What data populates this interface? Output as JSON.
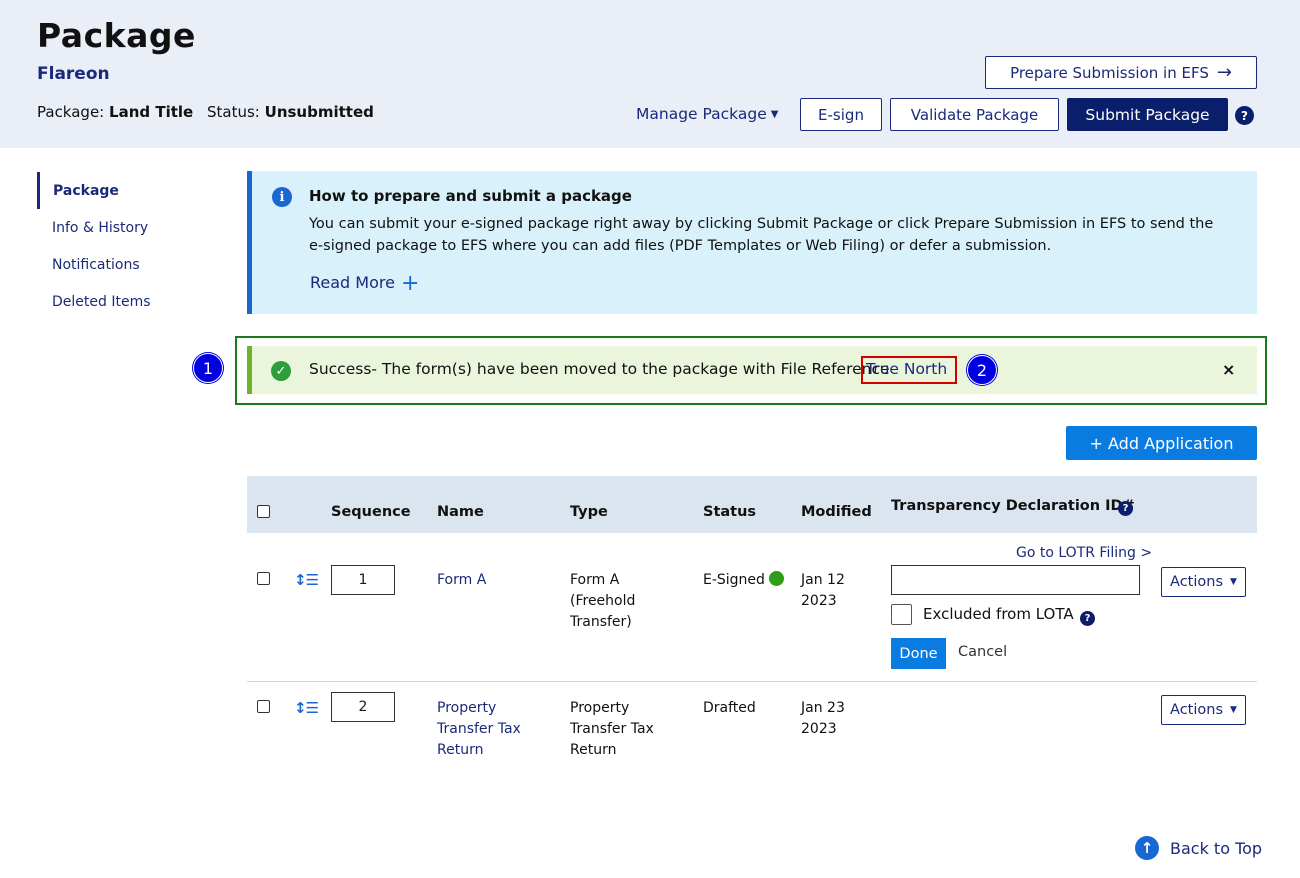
{
  "header": {
    "title": "Package",
    "org": "Flareon",
    "package_label": "Package:",
    "package_value": "Land Title",
    "status_label": "Status:",
    "status_value": "Unsubmitted",
    "prepare_btn": "Prepare Submission in EFS",
    "manage_label": "Manage Package",
    "esign_btn": "E-sign",
    "validate_btn": "Validate Package",
    "submit_btn": "Submit Package",
    "help_glyph": "?"
  },
  "sidebar": {
    "items": [
      {
        "label": "Package"
      },
      {
        "label": "Info & History"
      },
      {
        "label": "Notifications"
      },
      {
        "label": "Deleted Items"
      }
    ]
  },
  "info": {
    "icon_glyph": "i",
    "title": "How to prepare and submit a package",
    "body": "You can submit your e-signed package right away by clicking Submit Package or click Prepare Submission in EFS to send the e-signed package to EFS where you can add files (PDF Templates or Web Filing) or defer a submission.",
    "read_more": "Read More"
  },
  "success": {
    "text": "Success- The form(s) have been moved to the package with File Reference",
    "link": "True North",
    "close_glyph": "×"
  },
  "annotations": {
    "badge_1": "1",
    "badge_2": "2"
  },
  "add_application": "+ Add Application",
  "table": {
    "headers": {
      "sequence": "Sequence",
      "name": "Name",
      "type": "Type",
      "status": "Status",
      "modified": "Modified",
      "tdid": "Transparency Declaration ID#"
    },
    "rows": [
      {
        "sequence": "1",
        "name": "Form A",
        "type_lines": [
          "Form A",
          "(Freehold",
          "Transfer)"
        ],
        "status": "E-Signed",
        "status_color": "#2e9e1a",
        "modified_lines": [
          "Jan 12",
          "2023"
        ],
        "actions": "Actions"
      },
      {
        "sequence": "2",
        "name_lines": [
          "Property",
          "Transfer Tax",
          "Return"
        ],
        "type_lines": [
          "Property",
          "Transfer Tax",
          "Return"
        ],
        "status": "Drafted",
        "modified_lines": [
          "Jan 23",
          "2023"
        ],
        "actions": "Actions"
      }
    ],
    "lotr_link": "Go to LOTR Filing >",
    "excluded_label": "Excluded from LOTA",
    "done_btn": "Done",
    "cancel_btn": "Cancel"
  },
  "back_to_top": "Back to Top",
  "colors": {
    "header_bg": "#e9eef7",
    "navy": "#0a1f6b",
    "accent_blue": "#0a7be0",
    "info_bg": "#d9f1fb",
    "success_bg": "#eaf5dc"
  }
}
